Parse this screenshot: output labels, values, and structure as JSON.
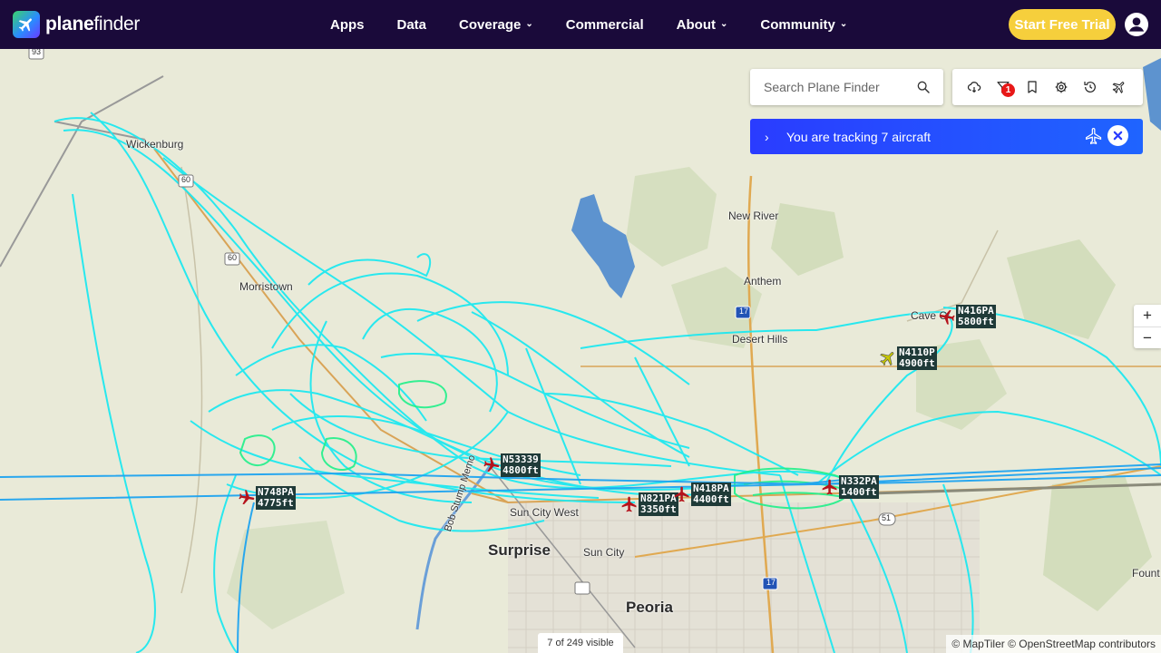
{
  "brand": {
    "name_bold": "plane",
    "name_light": "finder"
  },
  "nav": [
    {
      "label": "Apps",
      "dropdown": false
    },
    {
      "label": "Data",
      "dropdown": false
    },
    {
      "label": "Coverage",
      "dropdown": true
    },
    {
      "label": "Commercial",
      "dropdown": false
    },
    {
      "label": "About",
      "dropdown": true
    },
    {
      "label": "Community",
      "dropdown": true
    }
  ],
  "cta": {
    "label": "Start Free Trial"
  },
  "search": {
    "placeholder": "Search Plane Finder"
  },
  "toolbar": {
    "filter_badge": "1"
  },
  "tracking": {
    "text": "You are tracking 7 aircraft"
  },
  "zoom": {
    "in": "+",
    "out": "−"
  },
  "status": {
    "visible": "7 of 249 visible"
  },
  "attribution": "© MapTiler © OpenStreetMap contributors",
  "places": [
    {
      "id": "wickenburg",
      "label": "Wickenburg"
    },
    {
      "id": "morristown",
      "label": "Morristown"
    },
    {
      "id": "new-river",
      "label": "New River"
    },
    {
      "id": "anthem",
      "label": "Anthem"
    },
    {
      "id": "desert-hills",
      "label": "Desert Hills"
    },
    {
      "id": "cave-creek",
      "label": "Cave C"
    },
    {
      "id": "surprise",
      "label": "Surprise"
    },
    {
      "id": "sun-city",
      "label": "Sun City"
    },
    {
      "id": "sun-city-west",
      "label": "Sun City West"
    },
    {
      "id": "peoria",
      "label": "Peoria"
    },
    {
      "id": "fount",
      "label": "Fount"
    },
    {
      "id": "bob-stump",
      "label": "Bob Stump Memo"
    }
  ],
  "shields": {
    "s93": "93",
    "s60a": "60",
    "s60b": "60",
    "s17a": "17",
    "s17b": "17",
    "s51": "51"
  },
  "aircraft": [
    {
      "callsign": "N416PA",
      "altitude": "5800ft"
    },
    {
      "callsign": "N4110P",
      "altitude": "4900ft"
    },
    {
      "callsign": "N53339",
      "altitude": "4800ft"
    },
    {
      "callsign": "N748PA",
      "altitude": "4775ft"
    },
    {
      "callsign": "N821PA",
      "altitude": "3350ft"
    },
    {
      "callsign": "N418PA",
      "altitude": "4400ft"
    },
    {
      "callsign": "N332PA",
      "altitude": "1400ft"
    }
  ],
  "colors": {
    "nav_bg": "#1a0a3a",
    "cta": "#f6cf3c",
    "track": "#1ee8f0",
    "track_low": "#20f08a",
    "aircraft": "#b5121b",
    "tracking_banner": "#2a3cff"
  }
}
